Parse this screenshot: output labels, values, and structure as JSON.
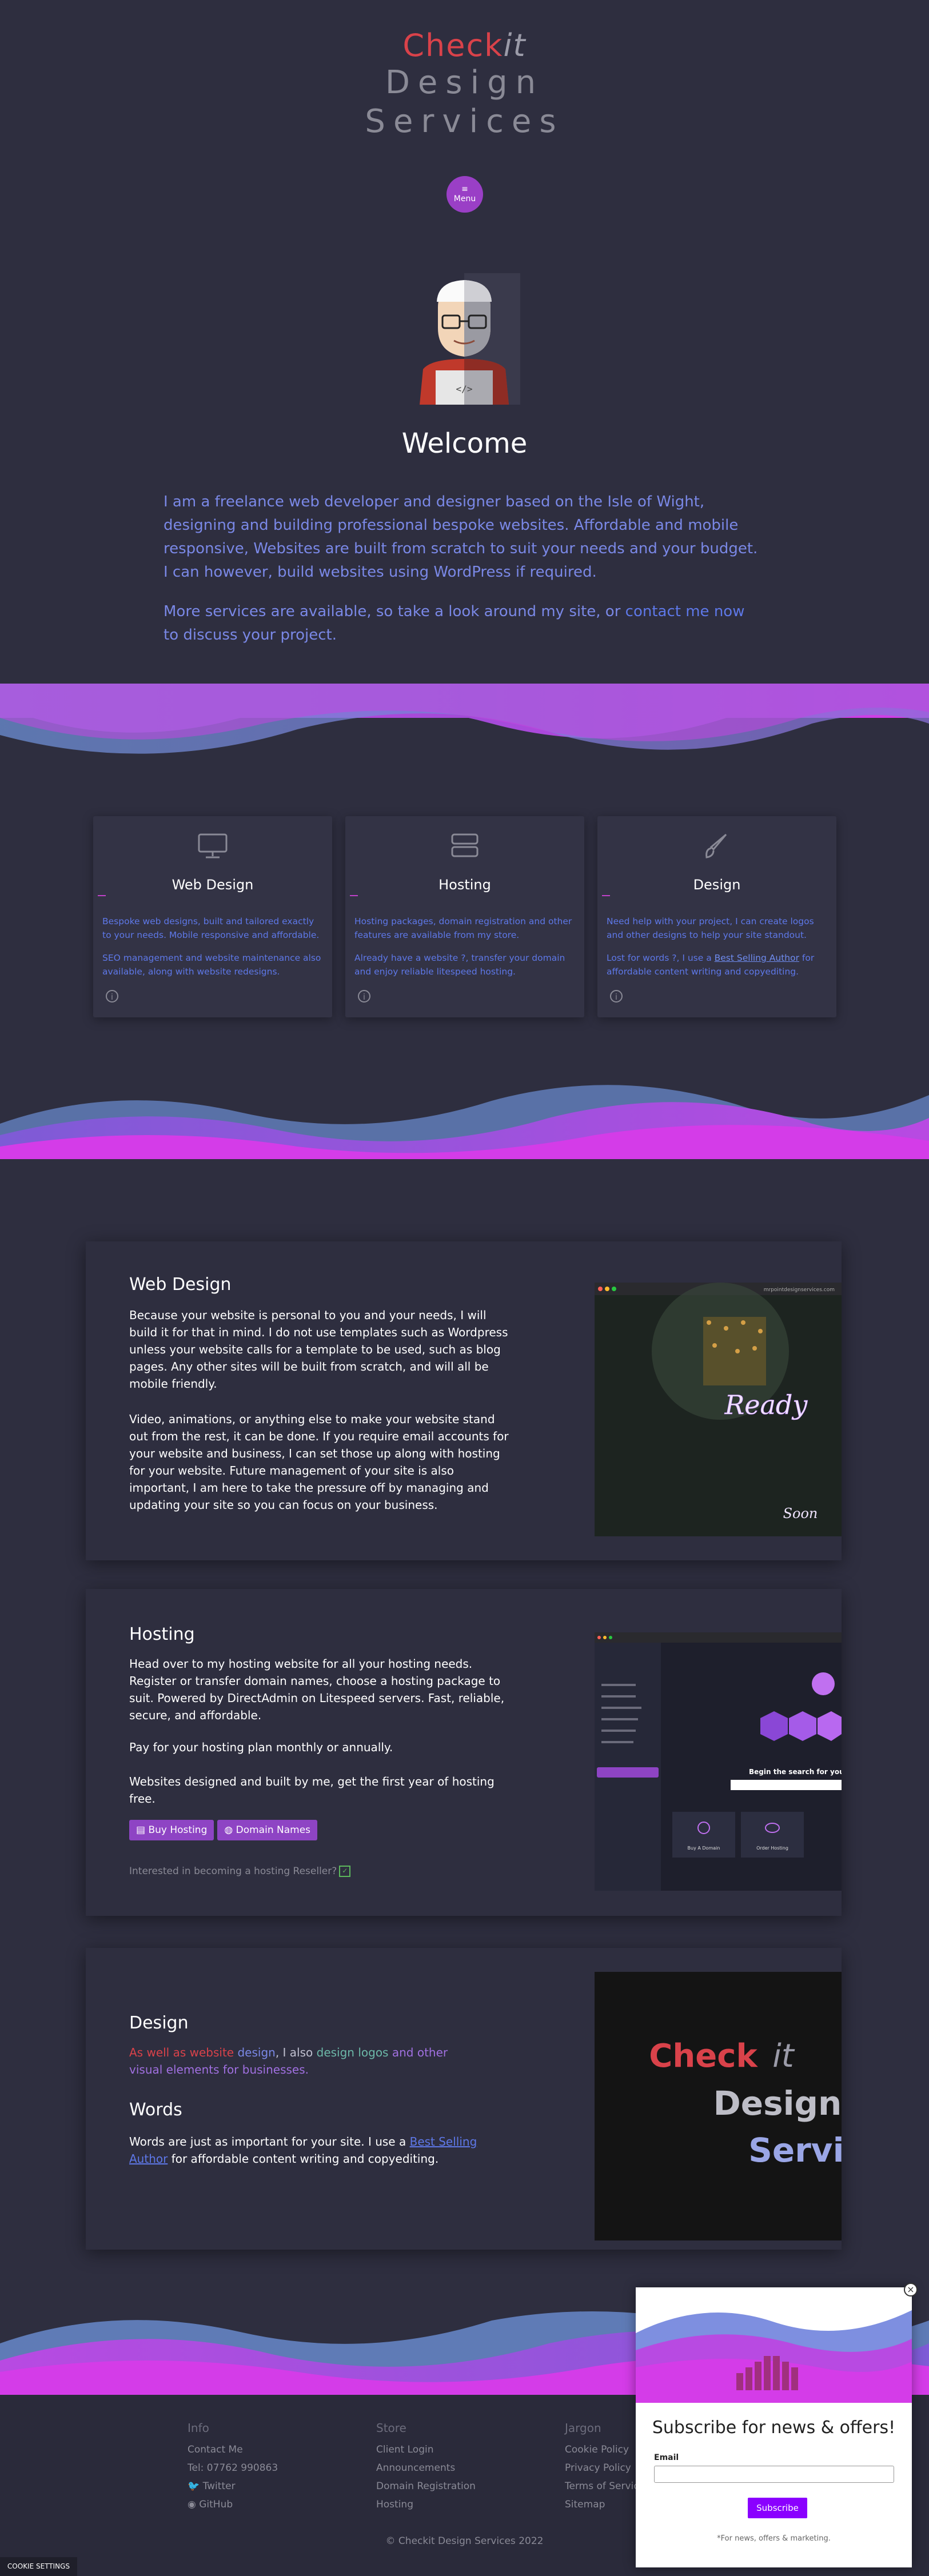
{
  "header": {
    "logo_check_red": "Check",
    "logo_it": "it",
    "logo_line2": "Design",
    "logo_line3": "Services",
    "menu_icon": "≡",
    "menu_label": "Menu"
  },
  "welcome": {
    "title": "Welcome",
    "para1": "I am a freelance web developer and designer based on the Isle of Wight, designing and building professional bespoke websites. Affordable and mobile responsive, Websites are built from scratch to suit your needs and your budget. I can however, build websites using WordPress if required.",
    "para2_pre": "More services are available, so take a look around my site, or ",
    "para2_link": "contact me now",
    "para2_post": " to discuss your project."
  },
  "services": [
    {
      "icon": "monitor-icon",
      "title": "Web Design",
      "p1": "Bespoke web designs, built and tailored exactly to your needs. Mobile responsive and affordable.",
      "p2": "SEO management and website maintenance also available, along with website redesigns."
    },
    {
      "icon": "server-icon",
      "title": "Hosting",
      "p1": "Hosting packages, domain registration and other features are available from my store.",
      "p2": "Already have a website ?, transfer your domain and enjoy reliable litespeed hosting."
    },
    {
      "icon": "brush-icon",
      "title": "Design",
      "p1": "Need help with your project, I can create logos and other designs to help your site standout.",
      "p2_pre": "Lost for words ?, I use a ",
      "p2_link": "Best Selling Author",
      "p2_post": " for affordable content writing and copyediting."
    }
  ],
  "web_design": {
    "title": "Web Design",
    "p1": "Because your website is personal to you and your needs, I will build it for that in mind. I do not use templates such as Wordpress unless your website calls for a template to be used, such as blog pages. Any other sites will be built from scratch, and will all be mobile friendly.",
    "p2": "Video, animations, or anything else to make your website stand out from the rest, it can be done. If you require email accounts for your website and business, I can set those up along with hosting for your website. Future management of your site is also important, I am here to take the pressure off by managing and updating your site so you can focus on your business.",
    "shot_url": "mrpointdesignservices.com",
    "shot_ready": "Ready",
    "shot_soon": "Soon"
  },
  "hosting": {
    "title": "Hosting",
    "p1": "Head over to my hosting website for all your hosting needs. Register or transfer domain names, choose a hosting package to suit. Powered by DirectAdmin on Litespeed servers. Fast, reliable, secure, and affordable.",
    "p2": "Pay for your hosting plan monthly or annually.",
    "p3": "Websites designed and built by me, get the first year of hosting free.",
    "btn_buy": "Buy Hosting",
    "btn_domains": "Domain Names",
    "reseller": "Interested in becoming a hosting Reseller?",
    "shot_search": "Begin the search for your p",
    "shot_card1": "Buy A Domain",
    "shot_card2": "Order Hosting"
  },
  "design": {
    "title": "Design",
    "p1_a": "As well as website ",
    "p1_b": "design",
    "p1_c": ", I also ",
    "p1_d": "design logos",
    "p1_e": " and other visual elements for businesses.",
    "words_title": "Words",
    "p2_pre": "Words are just as important for your site. I use a ",
    "p2_link": "Best Selling Author",
    "p2_post": " for affordable content writing and copyediting.",
    "logo_check": "Check",
    "logo_it": "it",
    "logo_design": "Design",
    "logo_serv": "Servic"
  },
  "footer": {
    "info": {
      "title": "Info",
      "items": [
        "Contact Me",
        "Tel: 07762 990863",
        "Twitter",
        "GitHub"
      ]
    },
    "store": {
      "title": "Store",
      "items": [
        "Client Login",
        "Announcements",
        "Domain Registration",
        "Hosting"
      ]
    },
    "jargon": {
      "title": "Jargon",
      "items": [
        "Cookie Policy",
        "Privacy Policy",
        "Terms of Service",
        "Sitemap"
      ]
    },
    "copyright": "© Checkit Design Services 2022",
    "cookie": "COOKIE SETTINGS"
  },
  "popup": {
    "close": "×",
    "title": "Subscribe for news & offers!",
    "email_label": "Email",
    "email_value": "",
    "email_placeholder": "",
    "subscribe": "Subscribe",
    "note": "*For news, offers & marketing."
  },
  "colors": {
    "accent": "#9a3fc6",
    "link": "#5e78e8",
    "bg": "#2e2e3f",
    "wave_pink": "#d23be6",
    "wave_blue": "#6a8fd6"
  }
}
